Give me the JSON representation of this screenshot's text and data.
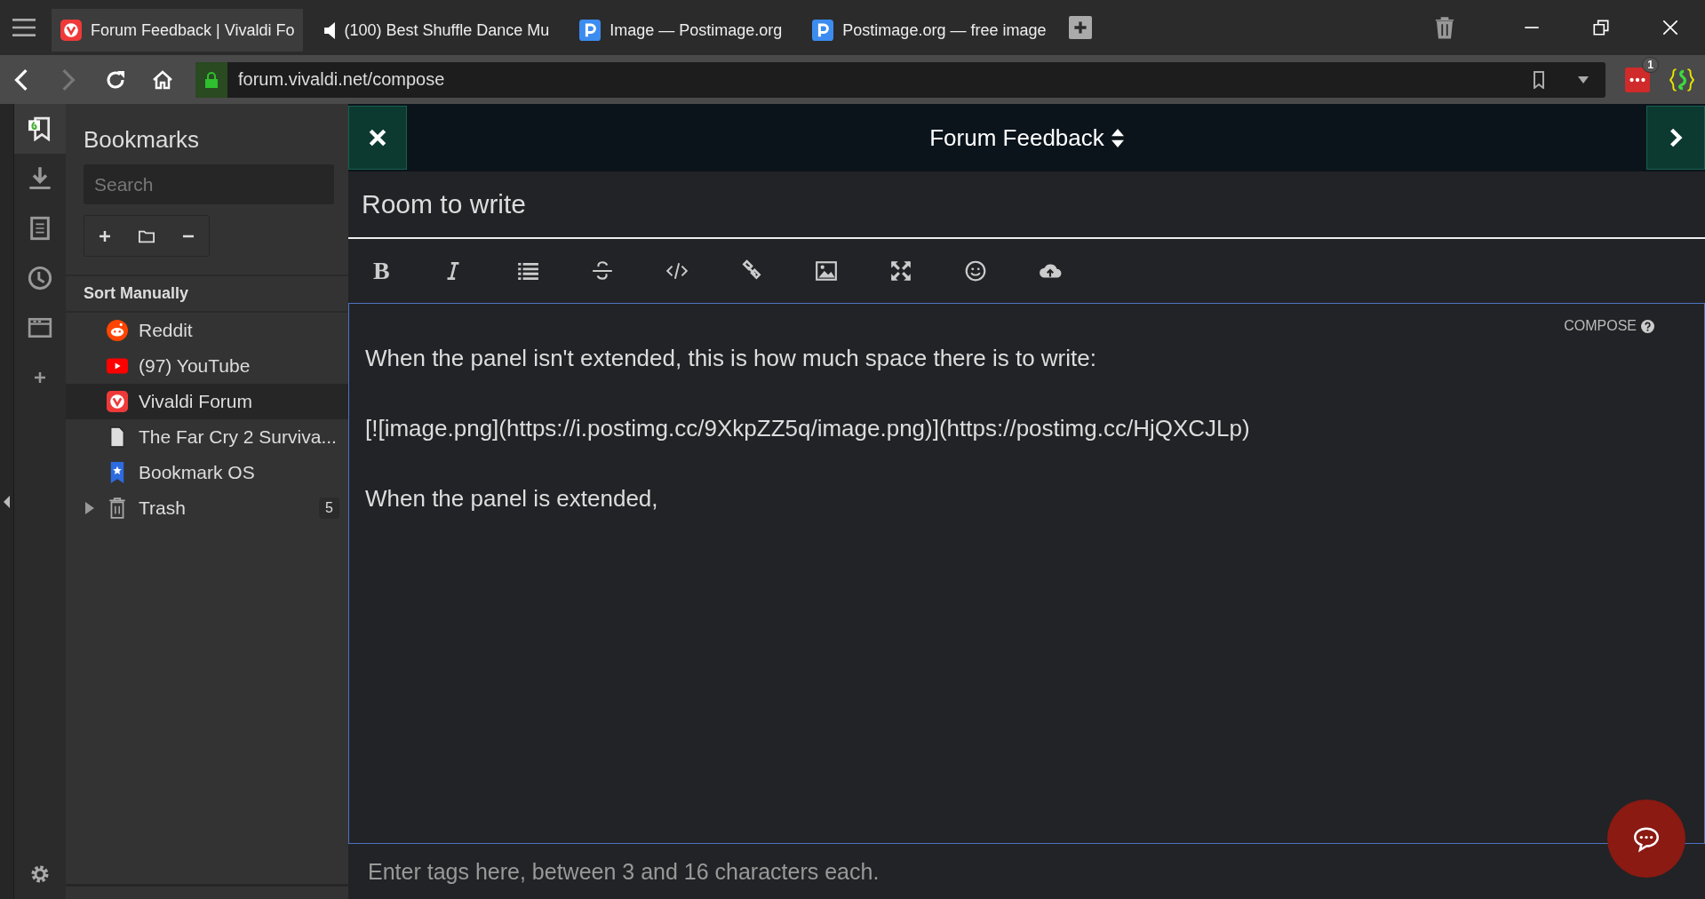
{
  "tabs": [
    {
      "title": "Forum Feedback | Vivaldi Fo",
      "kind": "vivaldi",
      "selected": true
    },
    {
      "title": "(100) Best Shuffle Dance Mu",
      "kind": "audio",
      "selected": false
    },
    {
      "title": "Image — Postimage.org",
      "kind": "postimage",
      "selected": false
    },
    {
      "title": "Postimage.org — free image",
      "kind": "postimage",
      "selected": false
    }
  ],
  "address_bar": {
    "url": "forum.vivaldi.net/compose"
  },
  "extensions": [
    {
      "kind": "chat",
      "badge": "1"
    },
    {
      "kind": "gecko"
    }
  ],
  "panel_strip": [
    {
      "kind": "bookmarks",
      "selected": true
    },
    {
      "kind": "downloads",
      "selected": false
    },
    {
      "kind": "notes",
      "selected": false
    },
    {
      "kind": "history",
      "selected": false
    },
    {
      "kind": "window",
      "selected": false
    },
    {
      "kind": "add",
      "selected": false
    }
  ],
  "bookmarks": {
    "title": "Bookmarks",
    "search": {
      "placeholder": "Search"
    },
    "sort_label": "Sort Manually",
    "items": [
      {
        "label": "Reddit",
        "kind": "reddit",
        "selected": false
      },
      {
        "label": "(97) YouTube",
        "kind": "youtube",
        "selected": false
      },
      {
        "label": "Vivaldi Forum",
        "kind": "vivaldi",
        "selected": true
      },
      {
        "label": "The Far Cry 2 Surviva...",
        "kind": "page",
        "selected": false
      },
      {
        "label": "Bookmark OS",
        "kind": "bookmarkos",
        "selected": false
      }
    ],
    "trash": {
      "label": "Trash",
      "count": "5",
      "expanded": false
    }
  },
  "composer": {
    "category": "Forum Feedback",
    "title": "Room to write",
    "toolbar": [
      {
        "kind": "bold",
        "label": "B"
      },
      {
        "kind": "italic"
      },
      {
        "kind": "list"
      },
      {
        "kind": "strike"
      },
      {
        "kind": "code"
      },
      {
        "kind": "link"
      },
      {
        "kind": "image"
      },
      {
        "kind": "fullscreen"
      },
      {
        "kind": "emoji"
      },
      {
        "kind": "upload"
      }
    ],
    "mode_label": "COMPOSE",
    "paragraphs": [
      "When the panel isn't extended, this is how much space there is to write:",
      "[![image.png](https://i.postimg.cc/9XkpZZ5q/image.png)](https://postimg.cc/HjQXCJLp)",
      "When the panel is extended,"
    ],
    "tags": {
      "placeholder": "Enter tags here, between 3 and 16 characters each."
    }
  }
}
